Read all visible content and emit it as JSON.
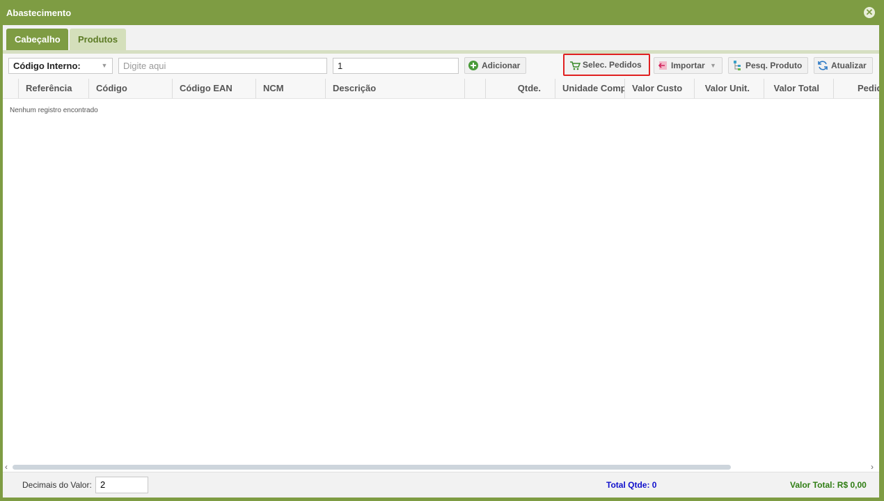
{
  "window": {
    "title": "Abastecimento"
  },
  "tabs": [
    {
      "label": "Cabeçalho",
      "active": true
    },
    {
      "label": "Produtos",
      "active": false
    }
  ],
  "toolbar": {
    "search_type": "Código Interno:",
    "search_placeholder": "Digite aqui",
    "quantity_value": "1",
    "add_label": "Adicionar",
    "select_orders_label": "Selec. Pedidos",
    "import_label": "Importar",
    "search_product_label": "Pesq. Produto",
    "refresh_label": "Atualizar"
  },
  "grid": {
    "columns": [
      "Referência",
      "Código",
      "Código EAN",
      "NCM",
      "Descrição",
      "",
      "Qtde.",
      "Unidade Comp",
      "Valor Custo",
      "Valor Unit.",
      "Valor Total",
      "Pedido"
    ],
    "empty_message": "Nenhum registro encontrado"
  },
  "footer": {
    "decimals_label": "Decimais do Valor:",
    "decimals_value": "2",
    "total_qtde": "Total Qtde: 0",
    "total_valor": "Valor Total: R$ 0,00"
  },
  "colors": {
    "accent": "#7e9c43",
    "highlight": "#e02020",
    "total_qtde": "#1010cc",
    "total_valor": "#2e7d12"
  }
}
